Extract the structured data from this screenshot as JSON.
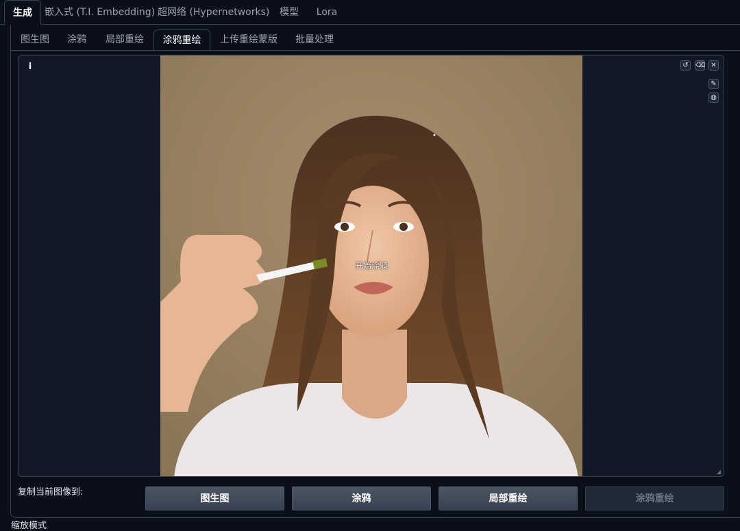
{
  "top_tabs": [
    {
      "label": "生成",
      "active": true
    },
    {
      "label": "嵌入式 (T.I. Embedding)",
      "active": false
    },
    {
      "label": "超网络 (Hypernetworks)",
      "active": false
    },
    {
      "label": "模型",
      "active": false
    },
    {
      "label": "Lora",
      "active": false
    }
  ],
  "sub_tabs": [
    {
      "label": "图生图",
      "active": false
    },
    {
      "label": "涂鸦",
      "active": false
    },
    {
      "label": "局部重绘",
      "active": false
    },
    {
      "label": "涂鸦重绘",
      "active": true
    },
    {
      "label": "上传重绘蒙版",
      "active": false
    },
    {
      "label": "批量处理",
      "active": false
    }
  ],
  "canvas": {
    "info_icon": "info-icon",
    "caption": "开始涂鸦",
    "tools": {
      "undo": "undo-icon",
      "clear": "eraser-icon",
      "close": "close-icon",
      "brush": "brush-icon",
      "color": "palette-icon"
    }
  },
  "copy_section": {
    "label": "复制当前图像到:",
    "buttons": [
      {
        "label": "图生图",
        "disabled": false
      },
      {
        "label": "涂鸦",
        "disabled": false
      },
      {
        "label": "局部重绘",
        "disabled": false
      },
      {
        "label": "涂鸦重绘",
        "disabled": true
      }
    ]
  },
  "scale_mode_label": "缩放模式",
  "colors": {
    "background": "#0b0f19",
    "panel": "#111827",
    "border": "#374151",
    "button": "#4b5563",
    "image_backdrop": "#9a8463"
  }
}
